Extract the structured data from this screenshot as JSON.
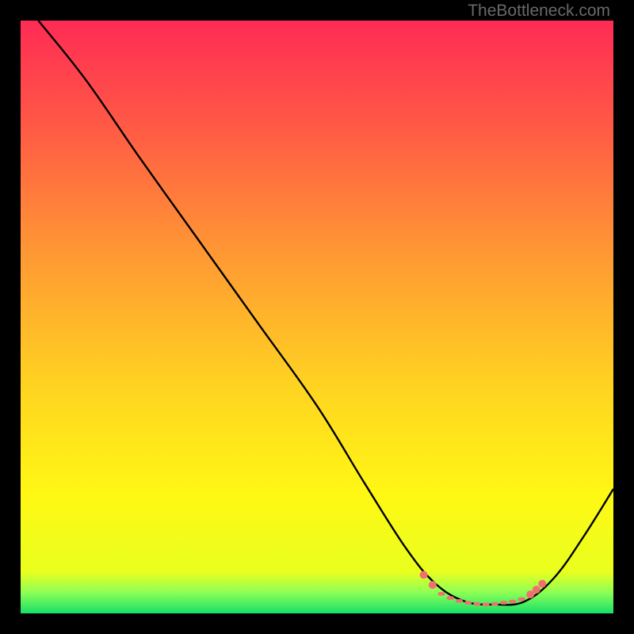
{
  "watermark": "TheBottleneck.com",
  "chart_data": {
    "type": "line",
    "title": "",
    "xlabel": "",
    "ylabel": "",
    "xlim": [
      0,
      100
    ],
    "ylim": [
      0,
      100
    ],
    "background_gradient": {
      "stops": [
        {
          "offset": 0,
          "color": "#ff2b55"
        },
        {
          "offset": 0.18,
          "color": "#ff5a45"
        },
        {
          "offset": 0.4,
          "color": "#ff9a33"
        },
        {
          "offset": 0.62,
          "color": "#ffd421"
        },
        {
          "offset": 0.8,
          "color": "#fff814"
        },
        {
          "offset": 0.93,
          "color": "#e9ff1e"
        },
        {
          "offset": 0.965,
          "color": "#8cff55"
        },
        {
          "offset": 1.0,
          "color": "#16e06a"
        }
      ]
    },
    "series": [
      {
        "name": "bottleneck-curve",
        "color": "#000000",
        "points": [
          {
            "x": 3,
            "y": 100
          },
          {
            "x": 11,
            "y": 90
          },
          {
            "x": 20,
            "y": 77
          },
          {
            "x": 30,
            "y": 63
          },
          {
            "x": 40,
            "y": 49
          },
          {
            "x": 50,
            "y": 35
          },
          {
            "x": 58,
            "y": 22
          },
          {
            "x": 65,
            "y": 11
          },
          {
            "x": 70,
            "y": 5
          },
          {
            "x": 75,
            "y": 2
          },
          {
            "x": 80,
            "y": 1.5
          },
          {
            "x": 85,
            "y": 2
          },
          {
            "x": 90,
            "y": 6
          },
          {
            "x": 95,
            "y": 13
          },
          {
            "x": 100,
            "y": 21
          }
        ]
      }
    ],
    "highlight": {
      "name": "optimal-range",
      "color": "#f07070",
      "dot_radius": 5,
      "dash_radius": 2.2,
      "points": [
        {
          "x": 68,
          "y": 6.5,
          "kind": "dot"
        },
        {
          "x": 69.5,
          "y": 4.8,
          "kind": "dot"
        },
        {
          "x": 71,
          "y": 3.3,
          "kind": "dash"
        },
        {
          "x": 72.5,
          "y": 2.6,
          "kind": "dash"
        },
        {
          "x": 74,
          "y": 2.1,
          "kind": "dash"
        },
        {
          "x": 75.5,
          "y": 1.8,
          "kind": "dash"
        },
        {
          "x": 77,
          "y": 1.6,
          "kind": "dash"
        },
        {
          "x": 78.5,
          "y": 1.5,
          "kind": "dash"
        },
        {
          "x": 80,
          "y": 1.6,
          "kind": "dash"
        },
        {
          "x": 81.5,
          "y": 1.8,
          "kind": "dash"
        },
        {
          "x": 83,
          "y": 2.0,
          "kind": "dash"
        },
        {
          "x": 84.5,
          "y": 2.4,
          "kind": "dash"
        },
        {
          "x": 86,
          "y": 3.2,
          "kind": "dot"
        },
        {
          "x": 87,
          "y": 4.0,
          "kind": "dot"
        },
        {
          "x": 88,
          "y": 5.0,
          "kind": "dot"
        }
      ]
    }
  }
}
